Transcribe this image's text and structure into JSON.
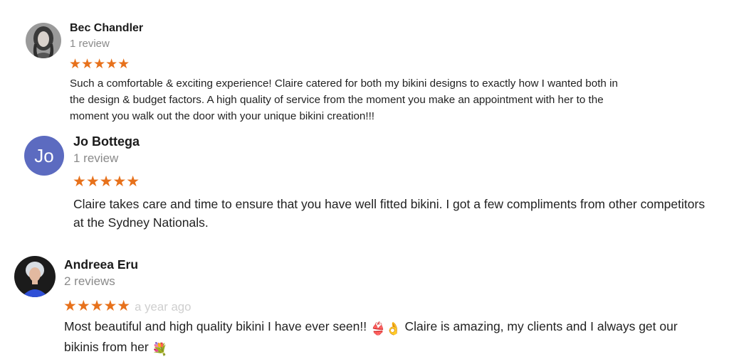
{
  "reviews": [
    {
      "name": "Bec Chandler",
      "review_count": "1 review",
      "rating": "★★★★★",
      "text": "Such a comfortable & exciting experience! Claire catered for both my bikini designs to exactly how I wanted both in the design & budget factors. A high quality of service from the moment you make an appointment with her to the moment you walk out the door with your unique bikini creation!!!",
      "avatar": "photo-avatar-icon"
    },
    {
      "name": "Jo Bottega",
      "review_count": "1 review",
      "rating": "★★★★★",
      "avatar_initials": "Jo",
      "avatar_color": "#5c6bc0",
      "text": "Claire takes care and time to ensure that you have well fitted bikini.  I got a few compliments from other competitors at the Sydney Nationals."
    },
    {
      "name": "Andreea Eru",
      "review_count": "2 reviews",
      "rating": "★★★★★",
      "time_ago": "a year ago",
      "text_part1": "Most beautiful and high quality bikini I have ever seen!!",
      "emoji1": "👙",
      "emoji2": "👌",
      "text_part2": "Claire is amazing, my clients and I always get our bikinis from her",
      "emoji3": "💐",
      "avatar": "photo-avatar-icon"
    }
  ],
  "colors": {
    "star": "#e7711b",
    "muted": "#8a8a8a",
    "text": "#222222"
  }
}
